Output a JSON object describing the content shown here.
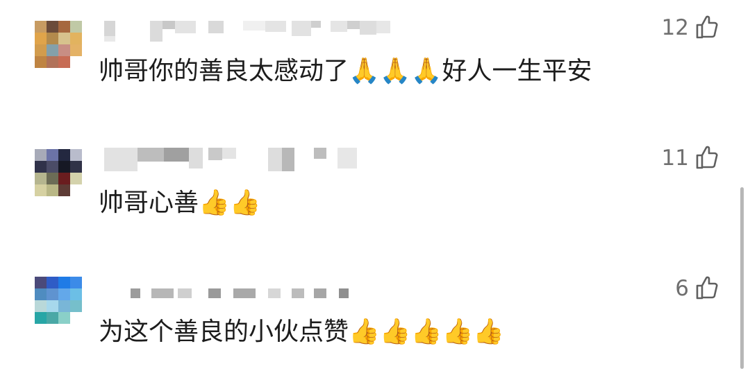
{
  "comments": [
    {
      "text": "帅哥你的善良太感动了🙏🙏🙏好人一生平安",
      "likes": "12"
    },
    {
      "text": "帅哥心善👍👍",
      "likes": "11"
    },
    {
      "text": "为这个善良的小伙点赞👍👍👍👍👍",
      "likes": "6"
    }
  ],
  "icons": {
    "like": "thumbs-up-outline-icon"
  },
  "colors": {
    "text": "#1c1c1c",
    "like_count": "#6f6f6f",
    "scrollbar": "#b7b7b7"
  }
}
